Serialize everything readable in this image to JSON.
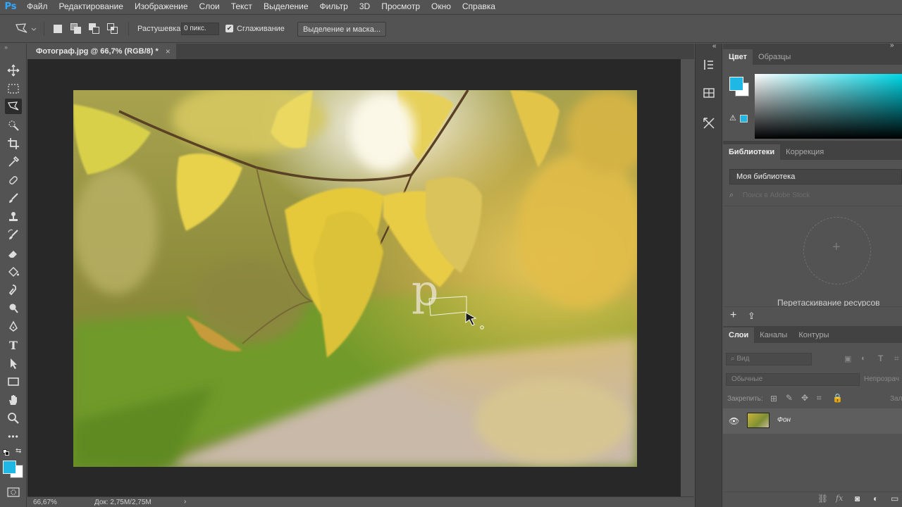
{
  "app": {
    "logo": "Ps"
  },
  "menu": [
    "Файл",
    "Редактирование",
    "Изображение",
    "Слои",
    "Текст",
    "Выделение",
    "Фильтр",
    "3D",
    "Просмотр",
    "Окно",
    "Справка"
  ],
  "options": {
    "tool_icon": "polygonal-lasso-icon",
    "feather_label": "Растушевка:",
    "feather_value": "0 пикс.",
    "antialias_label": "Сглаживание",
    "antialias_checked": true,
    "select_mask_label": "Выделение и маска..."
  },
  "document": {
    "tab_title": "Фотограф.jpg @ 66,7% (RGB/8) *",
    "close": "×"
  },
  "status": {
    "zoom": "66,67%",
    "doc": "Док: 2,75M/2,75M",
    "arrow": "›"
  },
  "colors": {
    "foreground": "#1fb8e4",
    "background": "#ffffff"
  },
  "color_panel": {
    "tabs": [
      "Цвет",
      "Образцы"
    ],
    "active": 0
  },
  "libraries_panel": {
    "tabs": [
      "Библиотеки",
      "Коррекция"
    ],
    "library_name": "Моя библиотека",
    "search_placeholder": "Поиск в Adobe Stock",
    "drag_text": "Перетаскивание ресурсов"
  },
  "layers_panel": {
    "tabs": [
      "Слои",
      "Каналы",
      "Контуры"
    ],
    "kind_filter": "Вид",
    "blend_mode": "Обычные",
    "opacity_label": "Непрозрач",
    "lock_label": "Закрепить:",
    "fill_label": "Зал",
    "layers": [
      {
        "name": "Фон",
        "visible": true
      }
    ]
  },
  "canvas_annotation": {
    "letter": "p"
  }
}
